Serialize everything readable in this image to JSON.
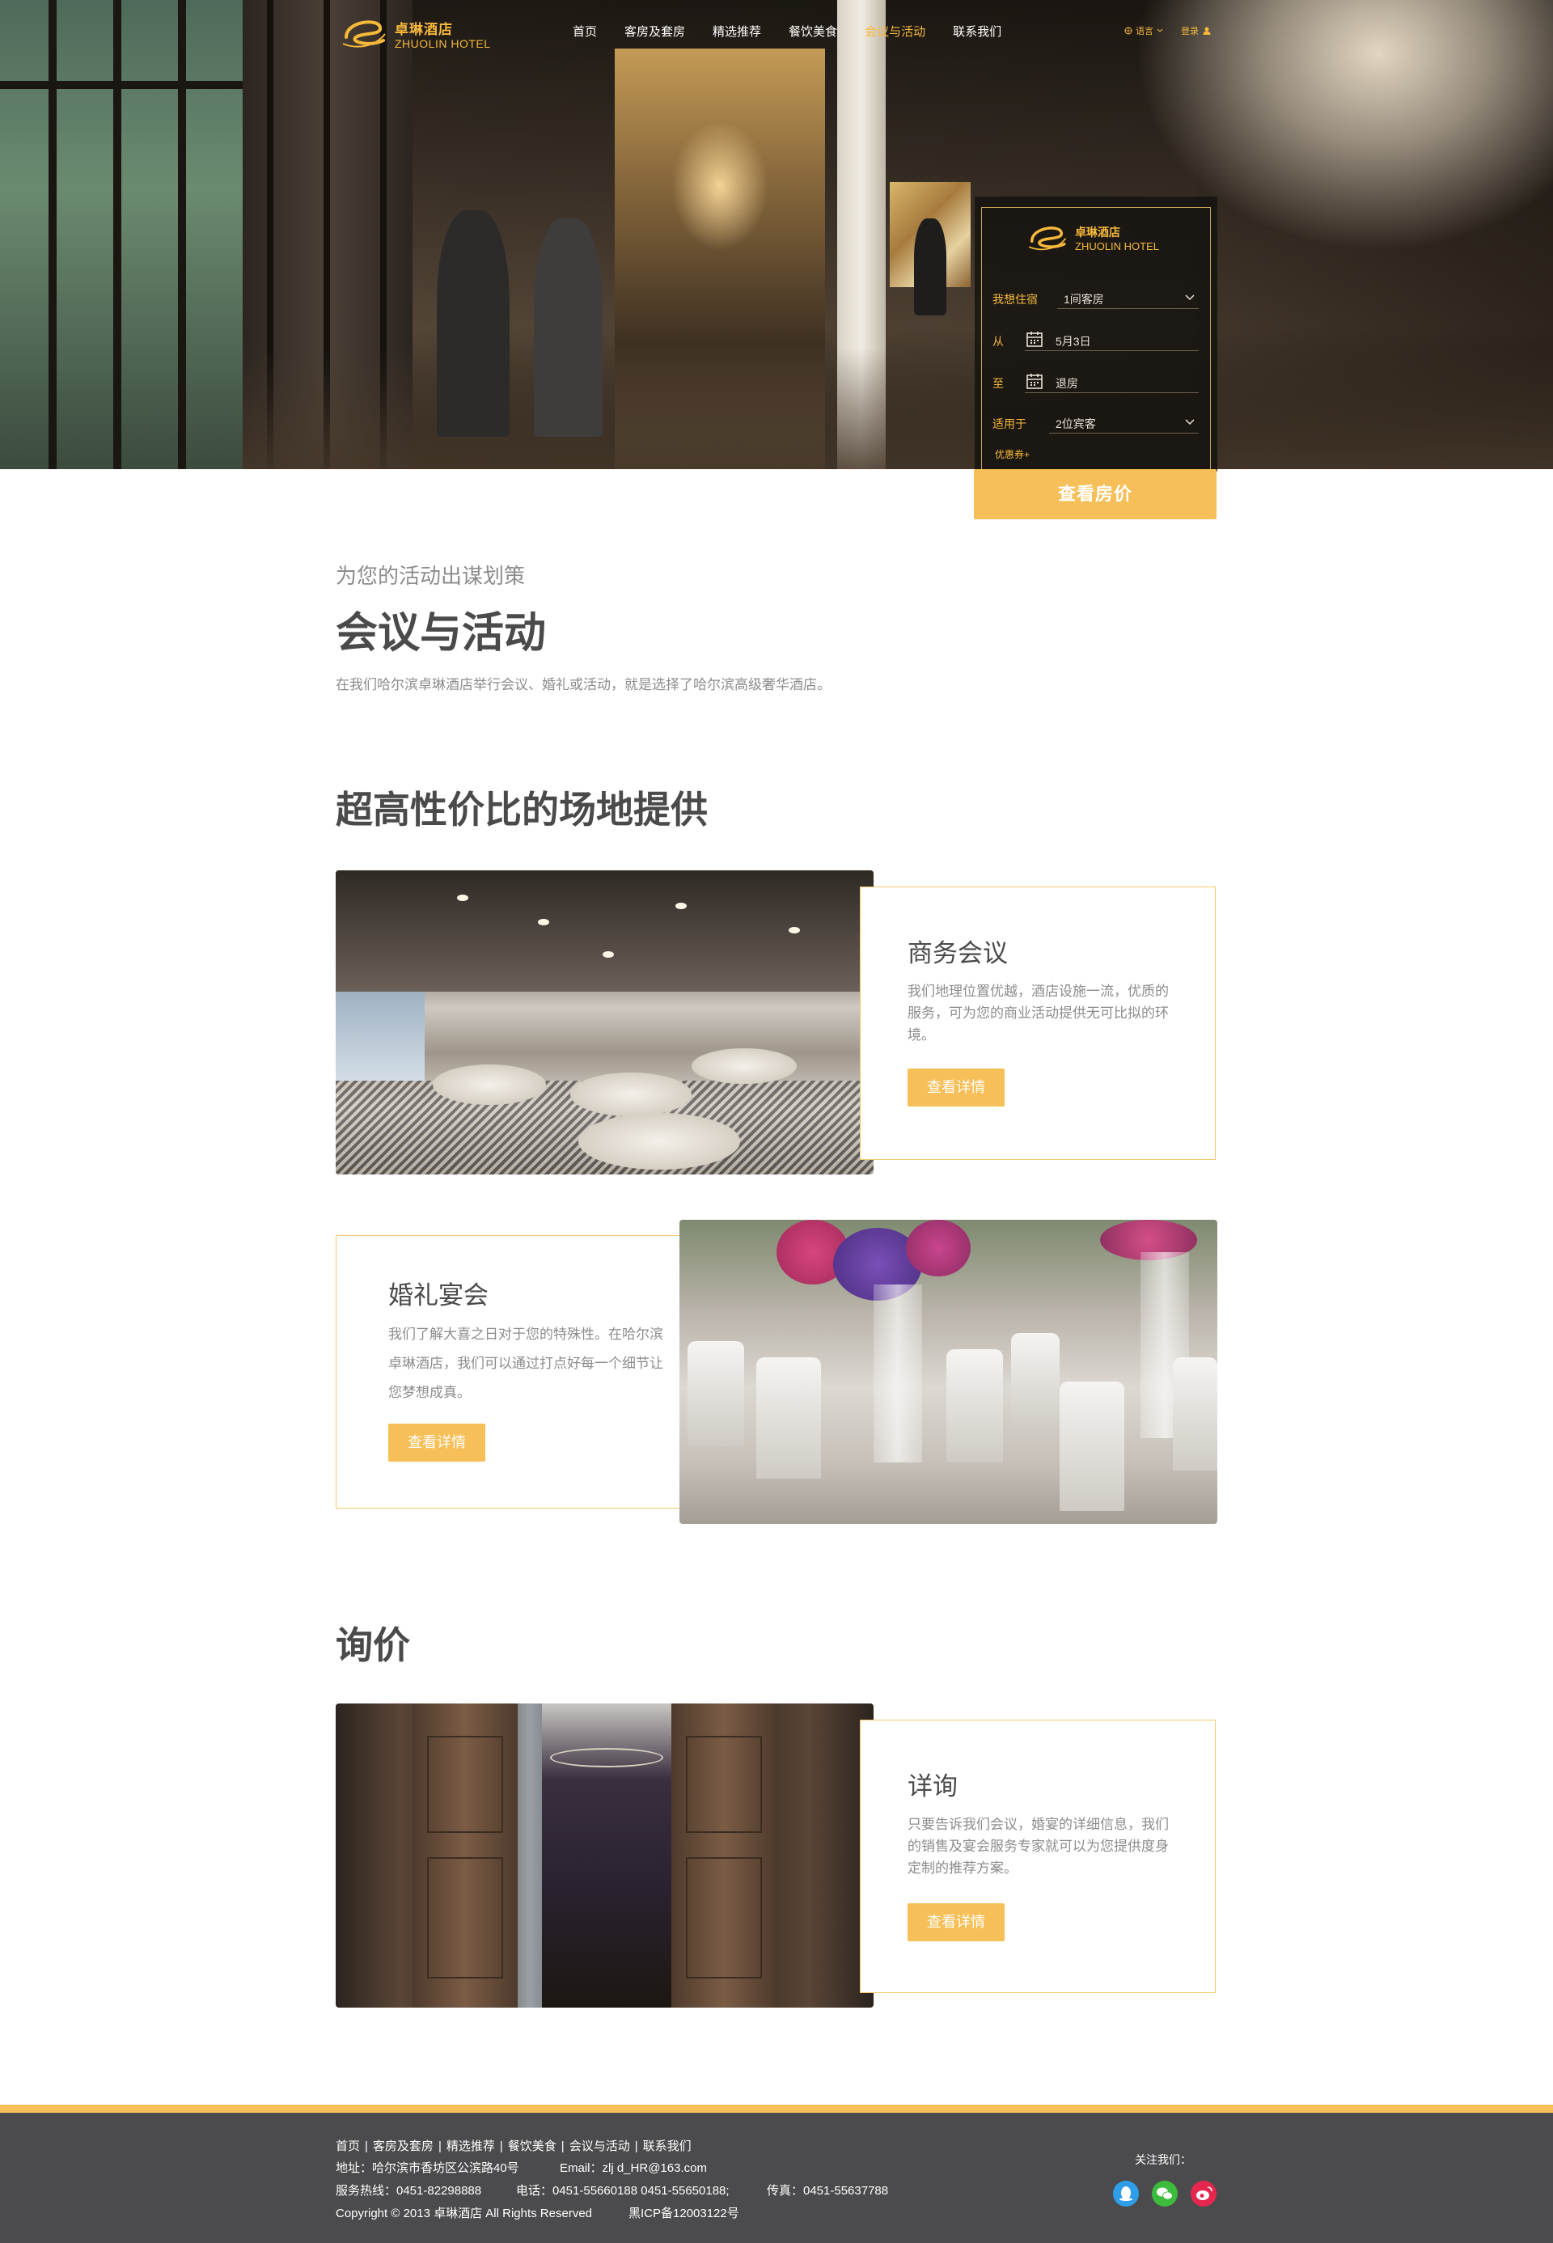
{
  "brand": {
    "cn": "卓琳酒店",
    "en": "ZHUOLIN HOTEL"
  },
  "nav": {
    "items": [
      {
        "label": "首页"
      },
      {
        "label": "客房及套房"
      },
      {
        "label": "精选推荐"
      },
      {
        "label": "餐饮美食"
      },
      {
        "label": "会议与活动"
      },
      {
        "label": "联系我们"
      }
    ],
    "active_index": 4,
    "lang_label": "语言",
    "login_label": "登录"
  },
  "booking": {
    "stay_label": "我想住宿",
    "room_value": "1间客房",
    "from_label": "从",
    "from_value": "5月3日",
    "to_label": "至",
    "to_value": "退房",
    "guests_label": "适用于",
    "guests_value": "2位宾客",
    "coupon_label": "优惠券+",
    "cta_label": "查看房价"
  },
  "intro": {
    "subtitle": "为您的活动出谋划策",
    "title": "会议与活动",
    "text": "在我们哈尔滨卓琳酒店举行会议、婚礼或活动，就是选择了哈尔滨高级奢华酒店。"
  },
  "venues": {
    "heading": "超高性价比的场地提供",
    "items": [
      {
        "title": "商务会议",
        "desc": "我们地理位置优越，酒店设施一流，优质的服务，可为您的商业活动提供无可比拟的环境。",
        "button": "查看详情"
      },
      {
        "title": "婚礼宴会",
        "desc": "我们了解大喜之日对于您的特殊性。在哈尔滨卓琳酒店，我们可以通过打点好每一个细节让您梦想成真。",
        "button": "查看详情"
      }
    ]
  },
  "inquiry": {
    "heading": "询价",
    "title": "详询",
    "desc": "只要告诉我们会议，婚宴的详细信息，我们的销售及宴会服务专家就可以为您提供度身定制的推荐方案。",
    "button": "查看详情"
  },
  "footer": {
    "links": [
      {
        "label": "首页"
      },
      {
        "label": "客房及套房"
      },
      {
        "label": "精选推荐"
      },
      {
        "label": "餐饮美食"
      },
      {
        "label": "会议与活动"
      },
      {
        "label": "联系我们"
      }
    ],
    "address": "地址：哈尔滨市香坊区公滨路40号",
    "email": "Email：zlj d_HR@163.com",
    "hotline": "服务热线：0451-82298888",
    "phone": "电话：0451-55660188  0451-55650188;",
    "fax": "传真：0451-55637788",
    "copyright": "Copyright © 2013 卓琳酒店 All Rights Reserved",
    "icp": "黑ICP备12003122号",
    "follow_label": "关注我们：",
    "social": [
      {
        "icon": "qq-icon",
        "color": "#2e9ee8"
      },
      {
        "icon": "wechat-icon",
        "color": "#3dbb3c"
      },
      {
        "icon": "weibo-icon",
        "color": "#e6274d"
      }
    ]
  },
  "colors": {
    "accent": "#f6bf57",
    "gold_text": "#f6b93b",
    "footer_bg": "#4b4b4d"
  }
}
